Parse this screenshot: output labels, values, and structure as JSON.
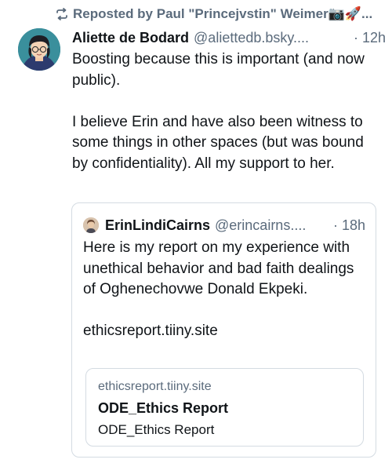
{
  "repost": {
    "text": "Reposted by Paul \"Princejvstin\" Weimer📷🚀...",
    "icon": "repost-icon"
  },
  "post": {
    "author_name": "Aliette de Bodard",
    "author_handle": "@aliettedb.bsky....",
    "time": "· 12h",
    "paragraphs": [
      "Boosting because this is important (and now public).",
      "I believe Erin and have also been witness to some things in other spaces (but was bound by confidentiality). All my support to her."
    ]
  },
  "quote": {
    "author_name": "ErinLindiCairns",
    "author_handle": "@erincairns....",
    "time": "· 18h",
    "paragraphs": [
      "Here is my report on my experience with unethical behavior and bad faith dealings of Oghenechovwe Donald Ekpeki.",
      "ethicsreport.tiiny.site"
    ],
    "link_card": {
      "domain": "ethicsreport.tiiny.site",
      "title": "ODE_Ethics Report",
      "description": "ODE_Ethics Report"
    }
  },
  "colors": {
    "text": "#101418",
    "muted": "#5b6b7c",
    "border": "#d4dbe2"
  }
}
